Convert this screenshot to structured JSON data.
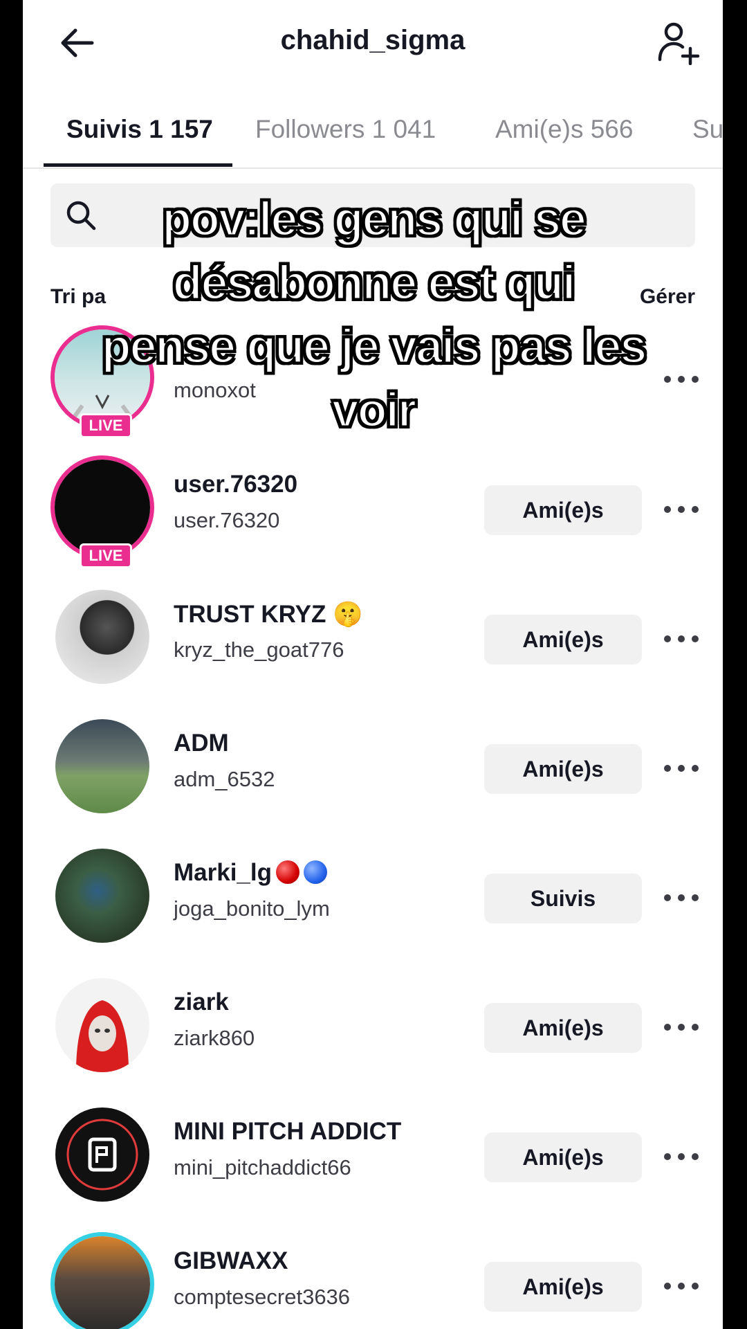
{
  "header": {
    "title": "chahid_sigma",
    "back_icon": "arrow-left-icon",
    "add_icon": "add-user-icon"
  },
  "tabs": [
    {
      "label": "Suivis 1 157",
      "active": true
    },
    {
      "label": "Followers 1 041",
      "active": false
    },
    {
      "label": "Ami(e)s 566",
      "active": false
    },
    {
      "label": "Su",
      "active": false
    }
  ],
  "search": {
    "placeholder": "",
    "icon": "search-icon"
  },
  "sort": {
    "label": "Tri pa",
    "manage_label": "Gérer"
  },
  "users": [
    {
      "name": "",
      "handle": "monoxot",
      "button": "",
      "live": true
    },
    {
      "name": "user.76320",
      "handle": "user.76320",
      "button": "Ami(e)s",
      "live": true
    },
    {
      "name": "TRUST KRYZ 🤫",
      "handle": "kryz_the_goat776",
      "button": "Ami(e)s",
      "live": false
    },
    {
      "name": "ADM",
      "handle": "adm_6532",
      "button": "Ami(e)s",
      "live": false
    },
    {
      "name": "Marki_lg",
      "handle": "joga_bonito_lym",
      "button": "Suivis",
      "live": false
    },
    {
      "name": "ziark",
      "handle": "ziark860",
      "button": "Ami(e)s",
      "live": false
    },
    {
      "name": "MINI PITCH ADDICT",
      "handle": "mini_pitchaddict66",
      "button": "Ami(e)s",
      "live": false
    },
    {
      "name": "GIBWAXX",
      "handle": "comptesecret3636",
      "button": "Ami(e)s",
      "live": false
    }
  ],
  "live_label": "LIVE",
  "caption": {
    "lines": [
      "pov:les gens qui se",
      "désabonne est qui",
      "pense que je vais pas les",
      "voir"
    ]
  },
  "colors": {
    "live": "#ea2e8f",
    "story_ring": "#35d0e4",
    "button_bg": "#f1f1f2",
    "text": "#161823"
  }
}
